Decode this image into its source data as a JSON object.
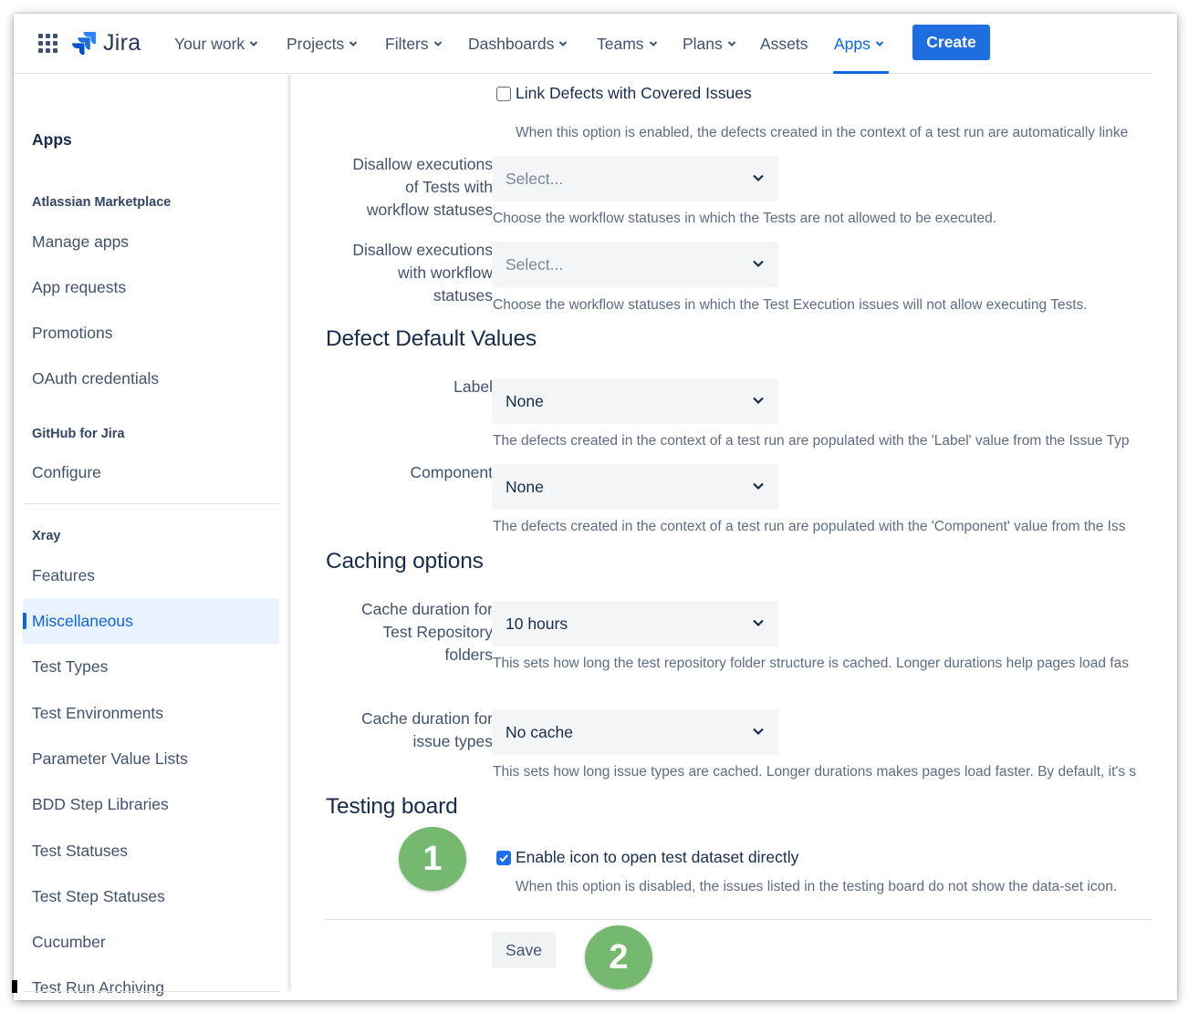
{
  "nav": {
    "logo_text": "Jira",
    "items": [
      {
        "label": "Your work",
        "dropdown": true
      },
      {
        "label": "Projects",
        "dropdown": true
      },
      {
        "label": "Filters",
        "dropdown": true
      },
      {
        "label": "Dashboards",
        "dropdown": true
      },
      {
        "label": "Teams",
        "dropdown": true
      },
      {
        "label": "Plans",
        "dropdown": true
      },
      {
        "label": "Assets",
        "dropdown": false
      },
      {
        "label": "Apps",
        "dropdown": true,
        "active": true
      }
    ],
    "create_label": "Create"
  },
  "sidebar": {
    "title": "Apps",
    "sections": [
      {
        "title": "Atlassian Marketplace",
        "items": [
          "Manage apps",
          "App requests",
          "Promotions",
          "OAuth credentials"
        ]
      },
      {
        "title": "GitHub for Jira",
        "items": [
          "Configure"
        ]
      },
      {
        "title": "Xray",
        "items": [
          "Features",
          "Miscellaneous",
          "Test Types",
          "Test Environments",
          "Parameter Value Lists",
          "BDD Step Libraries",
          "Test Statuses",
          "Test Step Statuses",
          "Cucumber",
          "Test Run Archiving"
        ]
      }
    ],
    "selected": "Miscellaneous"
  },
  "main": {
    "link_defects": {
      "label": "Link Defects with Covered Issues",
      "checked": false,
      "description": "When this option is enabled, the defects created in the context of a test run are automatically linke"
    },
    "disallow_tests": {
      "label_lines": [
        "Disallow executions",
        "of Tests with",
        "workflow statuses"
      ],
      "value": "Select...",
      "description": "Choose the workflow statuses in which the Tests are not allowed to be executed."
    },
    "disallow_executions": {
      "label_lines": [
        "Disallow executions",
        "with workflow",
        "statuses"
      ],
      "value": "Select...",
      "description": "Choose the workflow statuses in which the Test Execution issues will not allow executing Tests."
    },
    "defect_heading": "Defect Default Values",
    "label_field": {
      "label": "Label",
      "value": "None",
      "description": "The defects created in the context of a test run are populated with the 'Label' value from the Issue Typ"
    },
    "component_field": {
      "label": "Component",
      "value": "None",
      "description": "The defects created in the context of a test run are populated with the 'Component' value from the Iss"
    },
    "caching_heading": "Caching options",
    "cache_repo": {
      "label_lines": [
        "Cache duration for",
        "Test Repository",
        "folders"
      ],
      "value": "10 hours",
      "description": "This sets how long the test repository folder structure is cached. Longer durations help pages load fas"
    },
    "cache_issue_types": {
      "label_lines": [
        "Cache duration for",
        "issue types"
      ],
      "value": "No cache",
      "description": "This sets how long issue types are cached. Longer durations makes pages load faster. By default, it's s"
    },
    "testing_board_heading": "Testing board",
    "dataset_icon": {
      "label": "Enable icon to open test dataset directly",
      "checked": true,
      "description": "When this option is disabled, the issues listed in the testing board do not show the data-set icon."
    },
    "save_label": "Save"
  },
  "annotations": {
    "badge_1": "1",
    "badge_2": "2"
  },
  "colors": {
    "accent": "#0c66e4",
    "create_button": "#1f6ee0",
    "badge": "#74b96f"
  },
  "icons": [
    "app-switcher-icon",
    "jira-logo-icon",
    "chevron-down-icon",
    "checkmark-icon"
  ]
}
